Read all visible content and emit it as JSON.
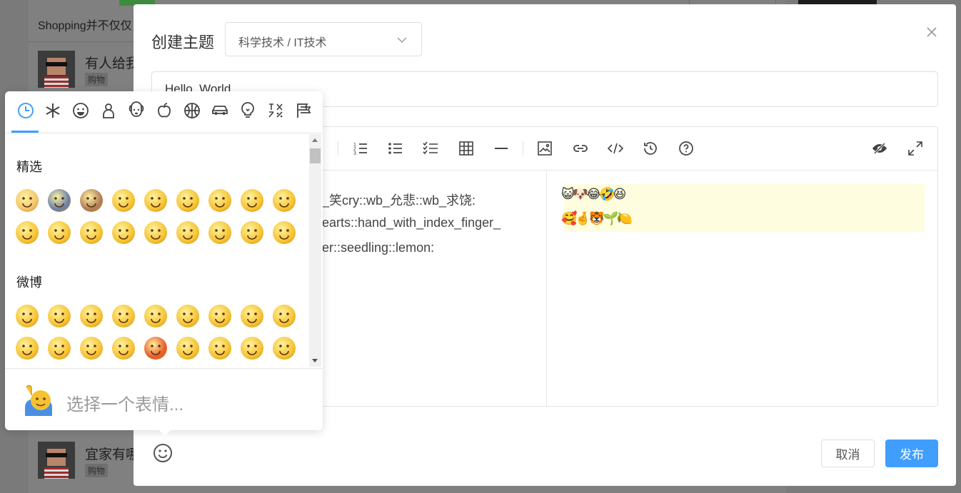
{
  "background": {
    "intro_text": "Shopping并不仅仅",
    "posts": [
      {
        "title": "有人给我",
        "tag": "购物"
      },
      {
        "title": "宜家有哪",
        "tag": "购物"
      }
    ]
  },
  "dialog": {
    "title": "创建主题",
    "category_value": "科学技术 / IT技术",
    "title_input_value": "Hello, World",
    "toolbar_icons": [
      "ordered-list-icon",
      "unordered-list-icon",
      "task-list-icon",
      "table-icon",
      "horizontal-rule-icon",
      "image-icon",
      "link-icon",
      "code-icon",
      "history-icon",
      "help-icon",
      "preview-toggle-icon",
      "fullscreen-icon"
    ],
    "editor_source_lines": [
      "_笑cry::wb_允悲::wb_求饶:",
      "earts::hand_with_index_finger_",
      "er::seedling::lemon:"
    ],
    "preview_lines": [
      "😺🐶😂🤣😆",
      "🥰🤞🐯🌱🍋"
    ],
    "cancel_label": "取消",
    "publish_label": "发布"
  },
  "emoji_picker": {
    "category_icons": [
      "recent-icon",
      "symbols-icon",
      "smileys-icon",
      "people-icon",
      "animals-icon",
      "food-icon",
      "activity-icon",
      "travel-icon",
      "objects-icon",
      "symbols-abc-icon",
      "flags-icon"
    ],
    "sections": [
      {
        "title": "精选",
        "emoji_colors": [
          "#f3c36b",
          "#6a7fa8",
          "#b07c5a",
          "#f6c232",
          "#f6c232",
          "#f6c232",
          "#f6c232",
          "#f6c232",
          "#f6c232",
          "#f6c232",
          "#f6c232",
          "#f6c232",
          "#f6c232",
          "#f6c232",
          "#f6c232",
          "#f6c232",
          "#f6c232",
          "#f6c232"
        ]
      },
      {
        "title": "微博",
        "emoji_colors": [
          "#f6c232",
          "#f6c232",
          "#f6c232",
          "#f6c232",
          "#f6c232",
          "#f6c232",
          "#f6c232",
          "#f6c232",
          "#f6c232",
          "#f6c232",
          "#f6c232",
          "#f6c232",
          "#f6c232",
          "#e85a2a",
          "#f6c232",
          "#f6c232",
          "#f6c232",
          "#f6c232"
        ]
      }
    ],
    "footer_placeholder": "选择一个表情..."
  },
  "colors": {
    "accent": "#409eff",
    "preview_highlight": "#fffde0"
  }
}
